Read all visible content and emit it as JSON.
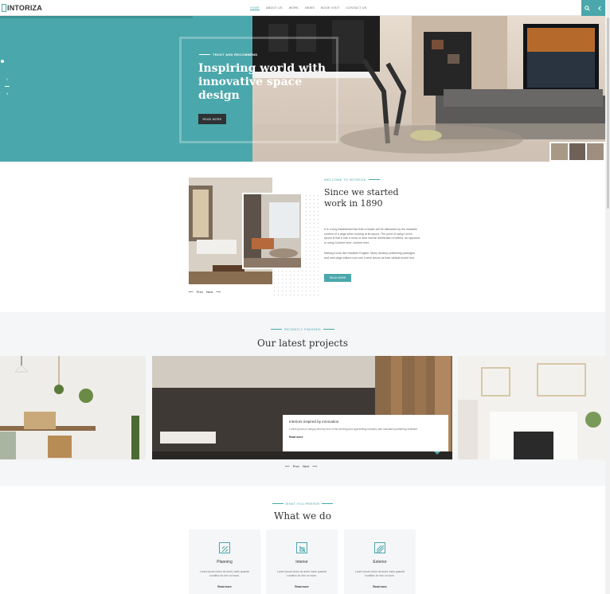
{
  "header": {
    "logo_text": "INTORIZA",
    "nav": [
      "HOME",
      "ABOUT US",
      "WORK",
      "NEWS",
      "BOOK VISIT",
      "CONTACT US"
    ],
    "search_icon": "search-icon",
    "menu_icon": "chevron-left-icon",
    "accent": "#4aa7ab"
  },
  "hero": {
    "eyebrow": "TRUST AND RECOMMEND",
    "title": "Inspiring world with innovative space design",
    "button": "READ MORE",
    "slide_numbers": [
      "1",
      "2",
      "3"
    ]
  },
  "about": {
    "eyebrow": "WELCOME TO INTORIZA",
    "title": "Since we started work in 1890",
    "p1": "It is a long established fact that a reader will be distracted by the readable content of a page when looking at its layout. The point of using Lorem Ipsum is that it has a more-or-less normal distribution of letters, as opposed to using Content here, content here.",
    "p2": "Making it look like readable English. Many desktop publishing packages and web page editors now use Lorem Ipsum as their default model text.",
    "button": "READ MORE",
    "prev": "Prev",
    "next": "Next"
  },
  "projects": {
    "eyebrow": "RECENTLY FINISHED",
    "title": "Our latest projects",
    "card_title": "Interiors inspired by innovation",
    "card_text": "Lorem ipsum is simply dummy text of the printing and typesetting industry with standard publishing software.",
    "card_link": "Read more",
    "prev": "Prev",
    "next": "Next"
  },
  "services": {
    "eyebrow": "WHAT YOU PREFER",
    "title": "What we do",
    "items": [
      {
        "title": "Planning",
        "text": "Lorem ipsum dolor sit amet, kaito quande conditus lor elm no nuse.",
        "link": "Read more",
        "icon": "planning-icon"
      },
      {
        "title": "Interior",
        "text": "Lorem ipsum dolor sit amet, kaito quande conditus lor elm no nuse.",
        "link": "Read more",
        "icon": "interior-icon"
      },
      {
        "title": "Exterior",
        "text": "Lorem ipsum dolor sit amet, kaito quande conditus lor elm no nuse.",
        "link": "Read more",
        "icon": "exterior-icon"
      }
    ]
  }
}
